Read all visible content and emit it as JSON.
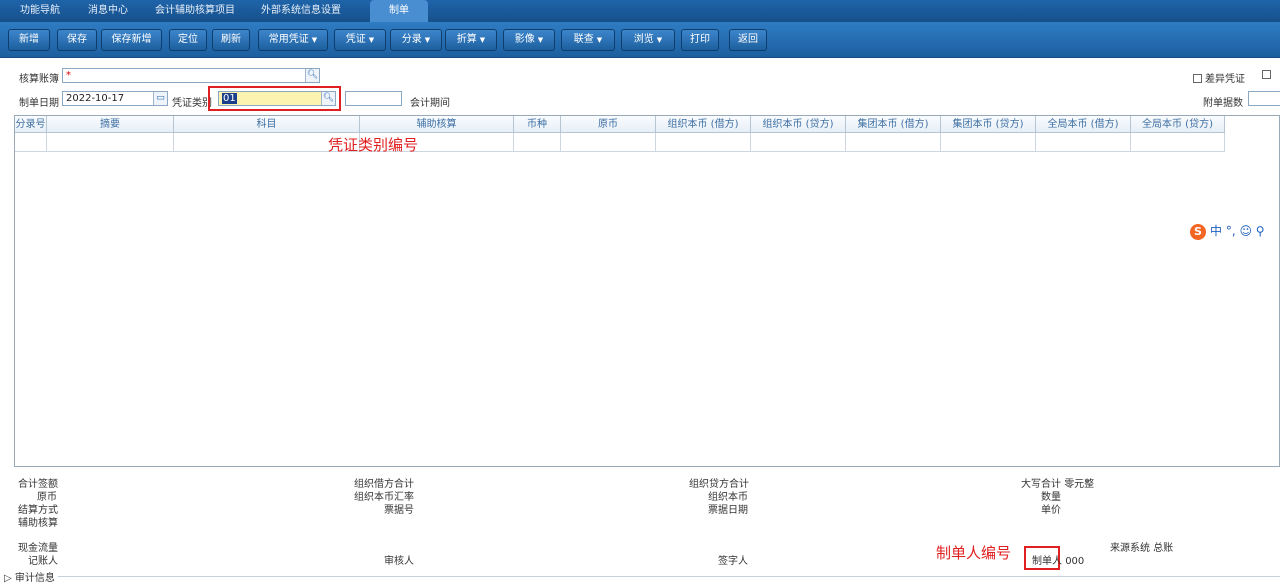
{
  "tabs": [
    "功能导航",
    "消息中心",
    "会计辅助核算项目",
    "外部系统信息设置",
    "制单"
  ],
  "toolbar": {
    "buttons": [
      "新增",
      "保存",
      "保存新增",
      "定位",
      "刷新",
      "常用凭证",
      "凭证",
      "分录",
      "折算",
      "影像",
      "联查",
      "浏览",
      "打印",
      "返回"
    ]
  },
  "form": {
    "ledger_label": "核算账簿",
    "ledger_required": "*",
    "date_label": "制单日期",
    "date_value": "2022-10-17",
    "vtype_label": "凭证类别",
    "vtype_value": "01",
    "period_label": "会计期间",
    "diff_voucher_label": "差异凭证",
    "attach_label": "附单据数"
  },
  "grid": {
    "columns": [
      "分录号",
      "摘要",
      "科目",
      "辅助核算",
      "币种",
      "原币",
      "组织本币 (借方)",
      "组织本币 (贷方)",
      "集团本币 (借方)",
      "集团本币 (贷方)",
      "全局本币 (借方)",
      "全局本币 (贷方)"
    ]
  },
  "annotations": {
    "voucher_type_code": "凭证类别编号",
    "creator_code": "制单人编号"
  },
  "footer": {
    "total_sign": "合计签额",
    "orig_currency": "原币",
    "settle_method": "结算方式",
    "aux_accounting": "辅助核算",
    "debit_total": "组织借方合计",
    "org_rate": "组织本币汇率",
    "bill_no": "票据号",
    "credit_total": "组织贷方合计",
    "org_currency": "组织本币",
    "bill_date": "票据日期",
    "uppercase_total": "大写合计",
    "uppercase_value": "零元整",
    "quantity": "数量",
    "unit_price": "单价",
    "cash_flow": "现金流量",
    "bookkeeper": "记账人",
    "auditor": "审核人",
    "signer": "签字人",
    "creator_label": "制单人",
    "creator_value": "000",
    "source_label": "来源系统",
    "source_value": "总账",
    "audit_info": "审计信息"
  },
  "ime": {
    "logo": "S",
    "text": "中 °, ☺ ⚲"
  },
  "colors": {
    "toolbar": "#1f64a9",
    "active_tab": "#4a8ed2",
    "annotation": "#e02020",
    "highlight": "#fdf3b0"
  }
}
